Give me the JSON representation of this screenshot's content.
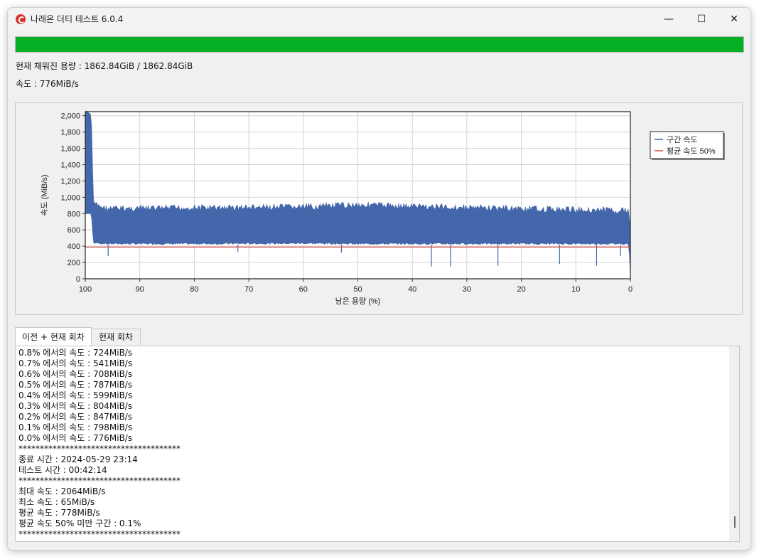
{
  "window": {
    "title": "나래온 더티 테스트 6.0.4",
    "minimize_glyph": "—",
    "maximize_glyph": "☐",
    "close_glyph": "✕"
  },
  "progress": {
    "fraction": 1.0,
    "color": "#06b025"
  },
  "info": {
    "capacity": "현재 채워진 용량 : 1862.84GiB / 1862.84GiB",
    "speed": "속도 : 776MiB/s"
  },
  "chart_data": {
    "type": "area",
    "title": "",
    "xlabel": "남은 용량 (%)",
    "ylabel": "속도 (MiB/s)",
    "xlim": [
      100,
      0
    ],
    "ylim": [
      0,
      2050
    ],
    "x_ticks": [
      "100",
      "90",
      "80",
      "70",
      "60",
      "50",
      "40",
      "30",
      "20",
      "10",
      "0"
    ],
    "y_ticks": [
      "0",
      "200",
      "400",
      "600",
      "800",
      "1,000",
      "1,200",
      "1,400",
      "1,600",
      "1,800",
      "2,000"
    ],
    "grid": true,
    "legend_placement": "top-right, outside plot",
    "series": [
      {
        "name": "구간 속도",
        "color": "#4466aa",
        "band_x": [
          100,
          99.9,
          98.9,
          98.5,
          96,
          80,
          60,
          50,
          40,
          20,
          1,
          0.3,
          0
        ],
        "band_high": [
          2000,
          2064,
          2010,
          960,
          900,
          910,
          920,
          950,
          930,
          900,
          880,
          860,
          700
        ],
        "band_low": [
          800,
          800,
          800,
          430,
          420,
          420,
          425,
          420,
          420,
          420,
          420,
          420,
          65
        ],
        "dips": [
          [
            95.8,
            280
          ],
          [
            72,
            330
          ],
          [
            53,
            320
          ],
          [
            36.5,
            150
          ],
          [
            33,
            150
          ],
          [
            24.3,
            160
          ],
          [
            13,
            180
          ],
          [
            6.2,
            160
          ],
          [
            1.8,
            280
          ],
          [
            0,
            65
          ]
        ]
      },
      {
        "name": "평균 속도 50%",
        "color": "#e05555",
        "value": 389
      }
    ]
  },
  "tabs": [
    {
      "label": "이전 + 현재 회차",
      "active": true
    },
    {
      "label": "현재 회차",
      "active": false
    }
  ],
  "log": {
    "lines": [
      "0.8% 에서의 속도 : 724MiB/s",
      "0.7% 에서의 속도 : 541MiB/s",
      "0.6% 에서의 속도 : 708MiB/s",
      "0.5% 에서의 속도 : 787MiB/s",
      "0.4% 에서의 속도 : 599MiB/s",
      "0.3% 에서의 속도 : 804MiB/s",
      "0.2% 에서의 속도 : 847MiB/s",
      "0.1% 에서의 속도 : 798MiB/s",
      "0.0% 에서의 속도 : 776MiB/s",
      "**************************************",
      "종료 시간 : 2024-05-29 23:14",
      "테스트 시간 : 00:42:14",
      "**************************************",
      "최대 속도 : 2064MiB/s",
      "최소 속도 : 65MiB/s",
      "평균 속도 : 778MiB/s",
      "평균 속도 50% 미만 구간 : 0.1%",
      "**************************************"
    ]
  }
}
